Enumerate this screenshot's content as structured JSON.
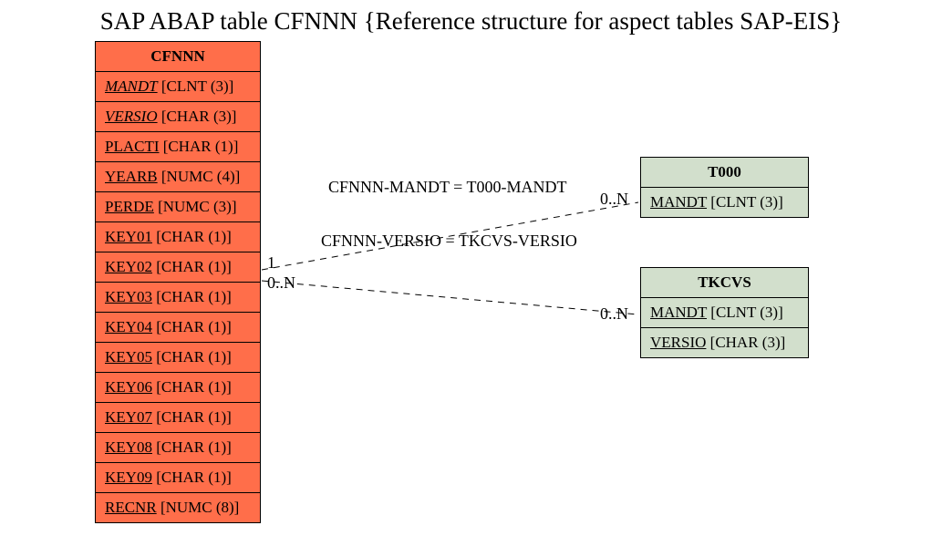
{
  "title": "SAP ABAP table CFNNN {Reference structure for aspect tables SAP-EIS}",
  "tables": {
    "cfnnn": {
      "name": "CFNNN",
      "fields": [
        {
          "name": "MANDT",
          "type": "[CLNT (3)]",
          "italic": true
        },
        {
          "name": "VERSIO",
          "type": "[CHAR (3)]",
          "italic": true
        },
        {
          "name": "PLACTI",
          "type": "[CHAR (1)]",
          "italic": false
        },
        {
          "name": "YEARB",
          "type": "[NUMC (4)]",
          "italic": false
        },
        {
          "name": "PERDE",
          "type": "[NUMC (3)]",
          "italic": false
        },
        {
          "name": "KEY01",
          "type": "[CHAR (1)]",
          "italic": false
        },
        {
          "name": "KEY02",
          "type": "[CHAR (1)]",
          "italic": false
        },
        {
          "name": "KEY03",
          "type": "[CHAR (1)]",
          "italic": false
        },
        {
          "name": "KEY04",
          "type": "[CHAR (1)]",
          "italic": false
        },
        {
          "name": "KEY05",
          "type": "[CHAR (1)]",
          "italic": false
        },
        {
          "name": "KEY06",
          "type": "[CHAR (1)]",
          "italic": false
        },
        {
          "name": "KEY07",
          "type": "[CHAR (1)]",
          "italic": false
        },
        {
          "name": "KEY08",
          "type": "[CHAR (1)]",
          "italic": false
        },
        {
          "name": "KEY09",
          "type": "[CHAR (1)]",
          "italic": false
        },
        {
          "name": "RECNR",
          "type": "[NUMC (8)]",
          "italic": false
        }
      ]
    },
    "t000": {
      "name": "T000",
      "fields": [
        {
          "name": "MANDT",
          "type": "[CLNT (3)]",
          "italic": false
        }
      ]
    },
    "tkcvs": {
      "name": "TKCVS",
      "fields": [
        {
          "name": "MANDT",
          "type": "[CLNT (3)]",
          "italic": false
        },
        {
          "name": "VERSIO",
          "type": "[CHAR (3)]",
          "italic": false
        }
      ]
    }
  },
  "relations": {
    "r1_label": "CFNNN-MANDT = T000-MANDT",
    "r2_label": "CFNNN-VERSIO = TKCVS-VERSIO",
    "left_card_top": "1",
    "left_card_bot": "0..N",
    "right_card_t000": "0..N",
    "right_card_tkcvs": "0..N"
  }
}
